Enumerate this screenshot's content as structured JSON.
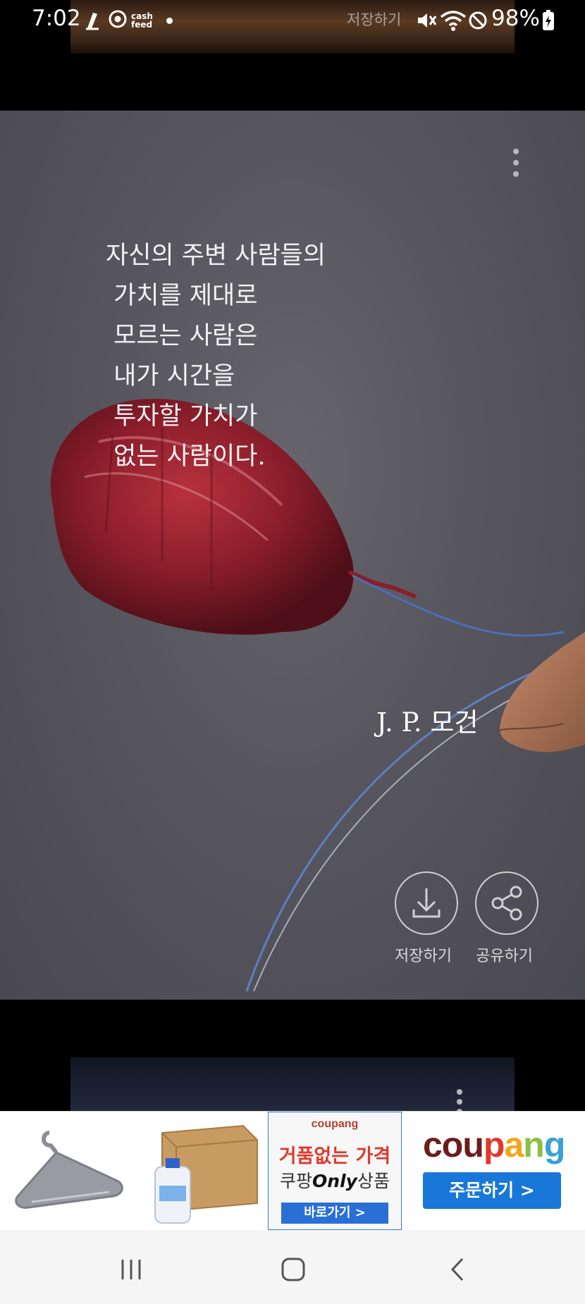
{
  "status_bar": {
    "time": "7:02",
    "notification_text": "cash feed",
    "ghost_label": "저장하기",
    "battery": "98%"
  },
  "quote_card": {
    "quote_lines": "자신의 주변 사람들의\n 가치를 제대로\n 모르는 사람은\n 내가 시간을\n 투자할 가치가\n 없는 사람이다.",
    "author": "J. P. 모건",
    "save_label": "저장하기",
    "share_label": "공유하기"
  },
  "ad": {
    "promo_brand": "coupang",
    "promo_line1": "거품없는 가격",
    "promo_line2_prefix": "쿠팡",
    "promo_line2_only": "Only",
    "promo_line2_suffix": "상품",
    "promo_button": "바로가기 >",
    "brand": "coupang",
    "order_button": "주문하기 >"
  },
  "colors": {
    "card_bg": "#57555d",
    "balloon": "#8e1e2c",
    "coupang_blue": "#1877d8",
    "coupang_red": "#e0392b"
  }
}
